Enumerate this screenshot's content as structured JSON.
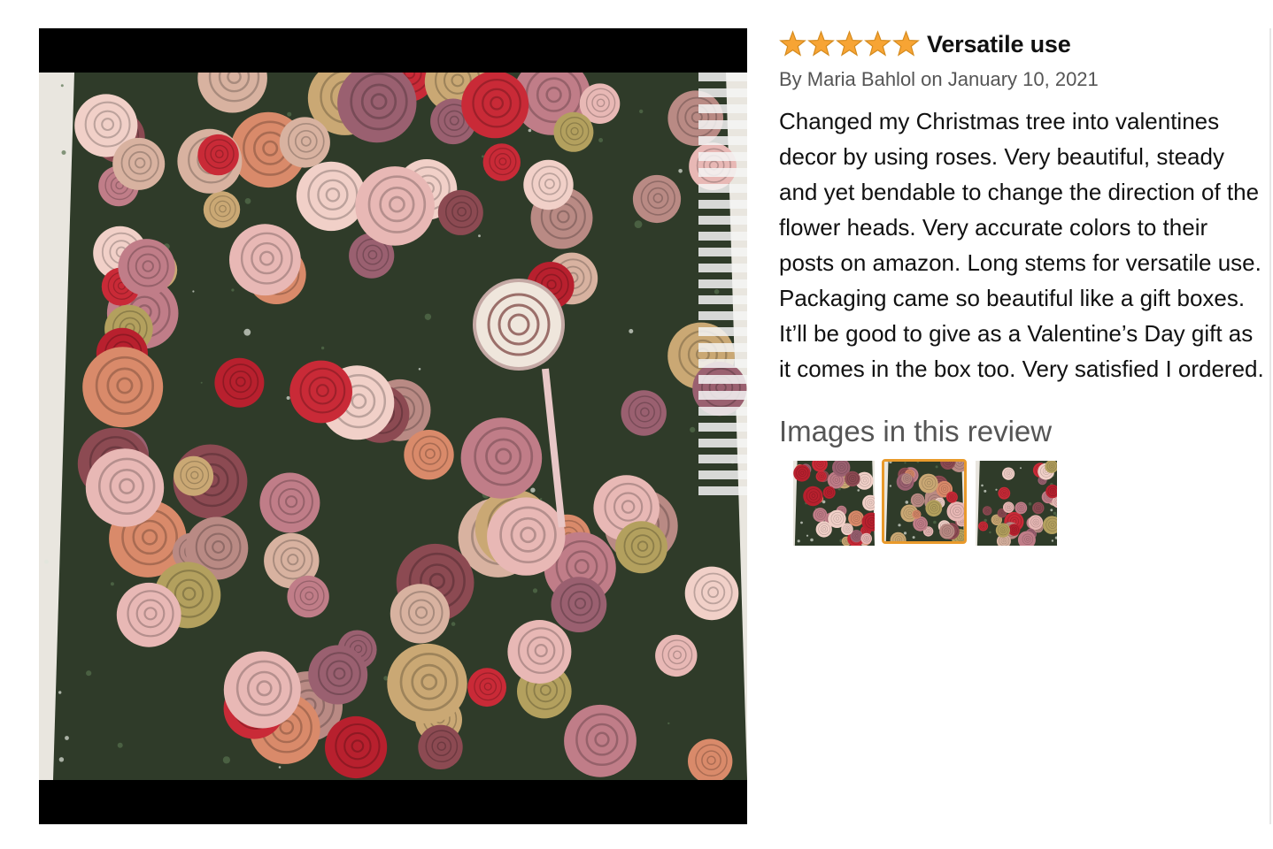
{
  "review": {
    "rating": 5,
    "rating_max": 5,
    "title": "Versatile use",
    "byline": "By Maria Bahlol on January 10, 2021",
    "body": "Changed my Christmas tree into valentines decor by using roses. Very beautiful, steady and yet bendable to change the direction of the flower heads. Very accurate colors to their posts on amazon. Long stems for versatile use. Packaging came so beautiful like a gift boxes. It’ll be good to give as a Valentine’s Day gift as it comes in the box too. Very satisfied I ordered."
  },
  "gallery": {
    "heading": "Images in this review",
    "thumbnail_count": 3,
    "selected_index": 2
  },
  "colors": {
    "star": "#f7a434",
    "star_outline": "#d48a1d",
    "selected_border": "#e99a2b",
    "letterbox": "#000000"
  }
}
